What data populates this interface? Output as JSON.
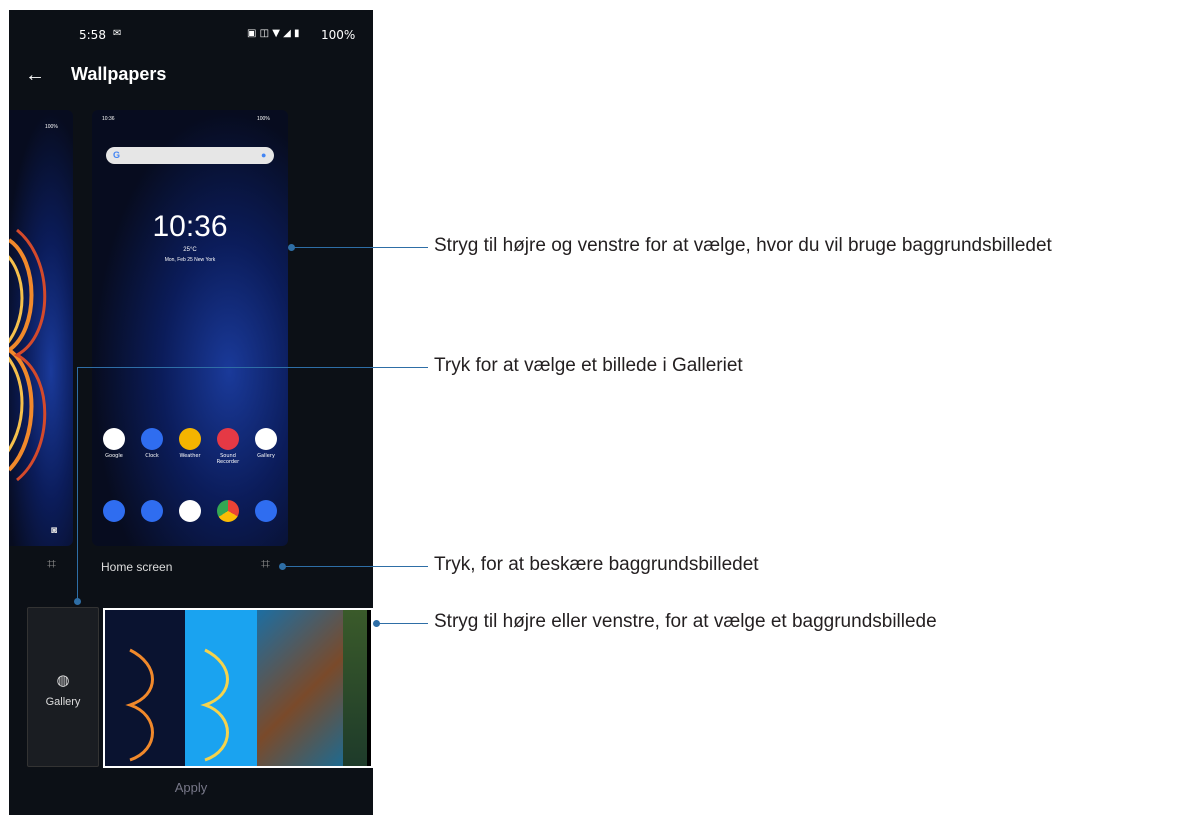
{
  "status_bar": {
    "time": "5:58",
    "battery": "100%"
  },
  "app_bar": {
    "title": "Wallpapers",
    "back_icon": "arrow-left-icon"
  },
  "lock_preview": {
    "status_battery": "100%"
  },
  "home_preview": {
    "status_time": "10:36",
    "status_battery": "100%",
    "search_g": "G",
    "clock_time": "10:36",
    "weather": "25°C",
    "date_location": "Mon, Feb 25  New York",
    "apps_row1": [
      "Google",
      "Clock",
      "Weather",
      "Sound Recorder",
      "Gallery"
    ],
    "colors_row1": [
      "#ffffff",
      "#2f6df0",
      "#f4b400",
      "#e53945",
      "#ffffff"
    ],
    "colors_row2": [
      "#2f6df0",
      "#2f6df0",
      "#ffffff",
      "#ffffff",
      "#2f6df0"
    ]
  },
  "home_screen_label": "Home screen",
  "gallery_button": {
    "label": "Gallery",
    "icon": "balloon-icon"
  },
  "apply_label": "Apply",
  "thumbnails": {
    "colors": [
      "#0a1330",
      "#1aa3f0",
      "#1c6ea2",
      "#1e3b2a"
    ]
  },
  "annotations": [
    "Stryg til højre og venstre for at vælge, hvor du vil bruge baggrundsbilledet",
    "Tryk for at vælge et billede i Galleriet",
    "Tryk, for at beskære baggrundsbilledet",
    "Stryg til højre eller venstre, for at vælge et baggrundsbillede"
  ],
  "accent_color": "#2e6ea6"
}
